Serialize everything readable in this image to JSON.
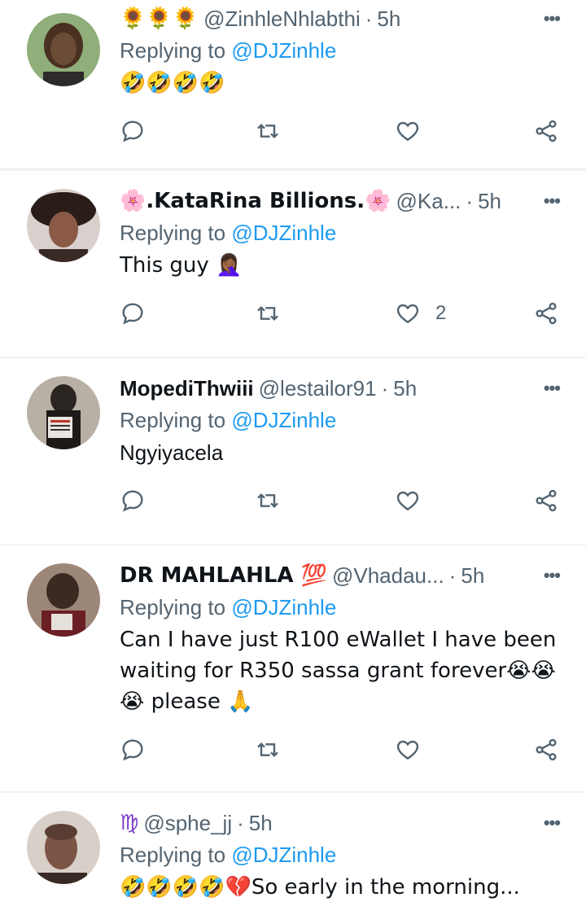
{
  "tweets": [
    {
      "display_name": "🌻🌻🌻",
      "handle": "@ZinhleNhlabthi",
      "time": "5h",
      "replying_label": "Replying to",
      "replying_to": "@DJZinhle",
      "text": "🤣🤣🤣🤣",
      "likes": "",
      "avatar_colors": [
        "#8fae7a",
        "#4a3020",
        "#6b4c36"
      ]
    },
    {
      "display_name": "🌸.KataRina Billions.🌸",
      "handle": "@Ka...",
      "time": "5h",
      "replying_label": "Replying to",
      "replying_to": "@DJZinhle",
      "text": "This guy 🤦🏾‍♀️",
      "likes": "2",
      "avatar_colors": [
        "#d8d0cc",
        "#2a1c18",
        "#8a5a46"
      ]
    },
    {
      "display_name": "MopediThwiii",
      "handle": "@lestailor91",
      "time": "5h",
      "replying_label": "Replying to",
      "replying_to": "@DJZinhle",
      "text": "Ngyiyacela",
      "likes": "",
      "avatar_colors": [
        "#b8b0a4",
        "#2b2522",
        "#e8e4e0"
      ]
    },
    {
      "display_name": "DR MAHLAHLA 💯",
      "handle": "@Vhadau...",
      "time": "5h",
      "replying_label": "Replying to",
      "replying_to": "@DJZinhle",
      "text_lines": [
        "Can I have just R100 eWallet I have been",
        "waiting for R350 sassa grant  forever😭😭",
        "😭 please 🙏"
      ],
      "likes": "",
      "avatar_colors": [
        "#9c8678",
        "#3b2a22",
        "#6a1f24"
      ]
    },
    {
      "display_name": "♍",
      "handle": "@sphe_jj",
      "time": "5h",
      "replying_label": "Replying to",
      "replying_to": "@DJZinhle",
      "text": "🤣🤣🤣🤣💔So early in the morning...",
      "likes": "",
      "avatar_colors": [
        "#d9cfc9",
        "#5a3d32",
        "#7b5546"
      ]
    }
  ],
  "icons": {
    "reply": "reply-icon",
    "retweet": "retweet-icon",
    "like": "like-icon",
    "share": "share-icon",
    "more": "more-icon"
  },
  "colors": {
    "link": "#1d9bf0",
    "secondary": "#536471",
    "divider": "#eff3f4"
  }
}
